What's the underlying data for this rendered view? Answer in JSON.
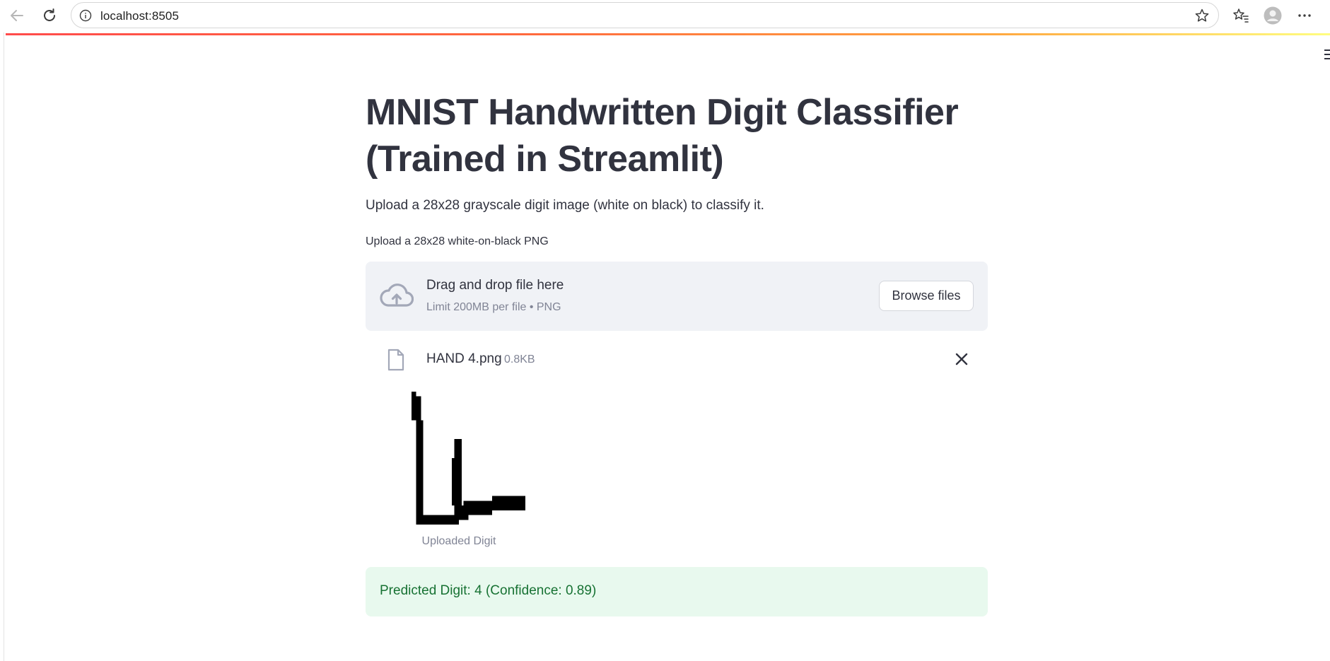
{
  "browser": {
    "url": "localhost:8505"
  },
  "page": {
    "title_line1": "MNIST Handwritten Digit Classifier",
    "title_line2": "(Trained in Streamlit)",
    "subtitle": "Upload a 28x28 grayscale digit image (white on black) to classify it."
  },
  "uploader": {
    "label": "Upload a 28x28 white-on-black PNG",
    "drop_title": "Drag and drop file here",
    "limit": "Limit 200MB per file • PNG",
    "browse_label": "Browse files",
    "file": {
      "name": "HAND 4.png",
      "size": "0.8KB"
    }
  },
  "image": {
    "caption": "Uploaded Digit"
  },
  "result": {
    "text": "Predicted Digit: 4 (Confidence: 0.89)"
  },
  "colors": {
    "accent": "#ff4b4b",
    "success_bg": "#e8f9ee",
    "success_text": "#177233",
    "dropzone_bg": "#f0f2f6"
  },
  "icons": [
    "back-arrow-icon",
    "refresh-icon",
    "info-icon",
    "star-icon",
    "favorites-icon",
    "profile-icon",
    "more-icon",
    "menu-icon",
    "cloud-upload-icon",
    "file-icon",
    "close-icon"
  ]
}
